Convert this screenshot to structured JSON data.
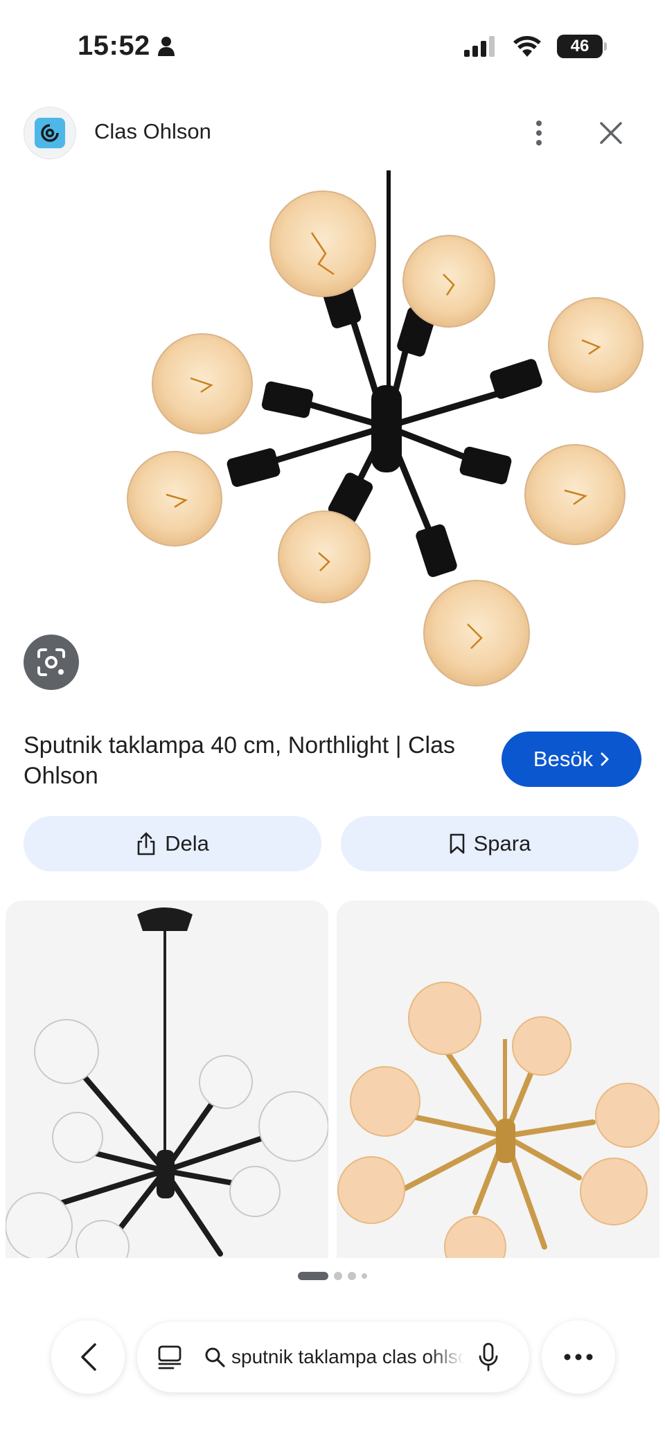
{
  "status_bar": {
    "time": "15:52",
    "battery": "46"
  },
  "header": {
    "site_name": "Clas Ohlson"
  },
  "result": {
    "title": "Sputnik taklampa 40 cm, Northlight | Clas Ohlson",
    "visit_label": "Besök"
  },
  "actions": {
    "share_label": "Dela",
    "save_label": "Spara"
  },
  "search": {
    "query": "sputnik taklampa clas ohlson"
  },
  "colors": {
    "accent": "#0b57d0",
    "action_bg": "#e8effd",
    "bulb": "#f6d9b0",
    "socket": "#111111",
    "brass": "#c99a4a"
  },
  "pagination": {
    "total": 4,
    "active": 1
  }
}
